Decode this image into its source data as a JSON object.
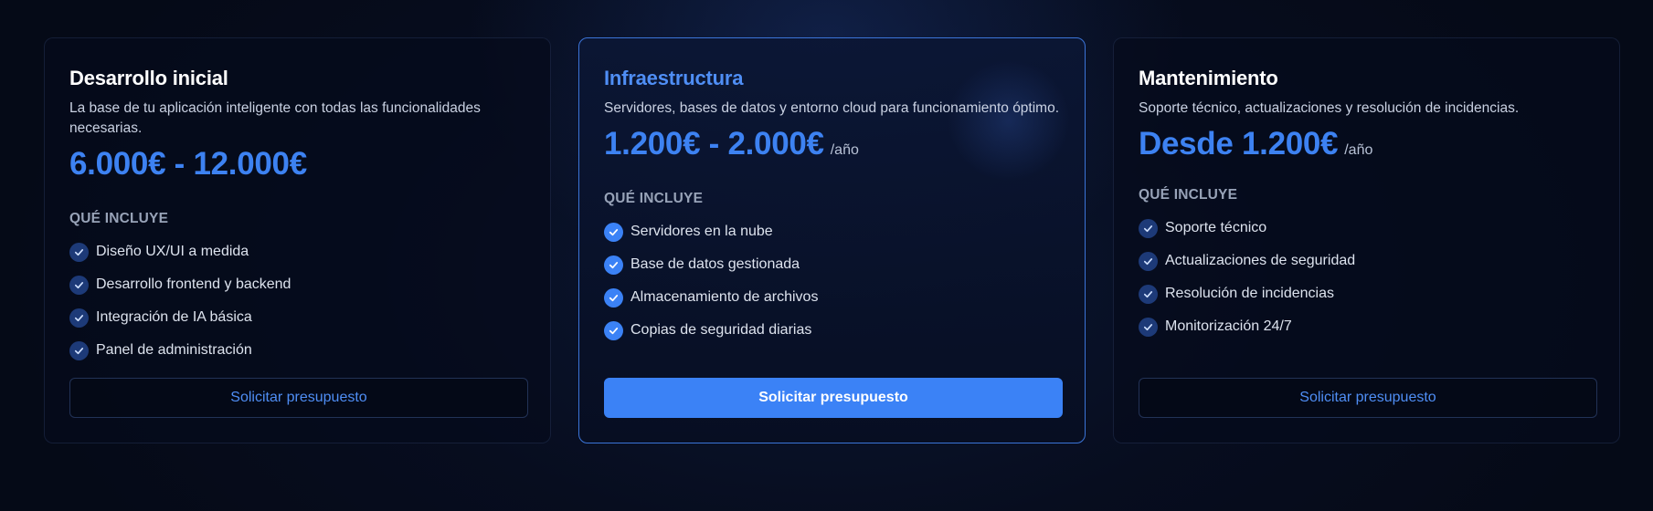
{
  "plans": [
    {
      "title": "Desarrollo inicial",
      "description": "La base de tu aplicación inteligente con todas las funcionalidades necesarias.",
      "price": "6.000€ - 12.000€",
      "period": "",
      "includes_label": "QUÉ INCLUYE",
      "features": [
        "Diseño UX/UI a medida",
        "Desarrollo frontend y backend",
        "Integración de IA básica",
        "Panel de administración"
      ],
      "button_label": "Solicitar presupuesto",
      "highlighted": false
    },
    {
      "title": "Infraestructura",
      "description": "Servidores, bases de datos y entorno cloud para funcionamiento óptimo.",
      "price": "1.200€ - 2.000€",
      "period": "/año",
      "includes_label": "QUÉ INCLUYE",
      "features": [
        "Servidores en la nube",
        "Base de datos gestionada",
        "Almacenamiento de archivos",
        "Copias de seguridad diarias"
      ],
      "button_label": "Solicitar presupuesto",
      "highlighted": true
    },
    {
      "title": "Mantenimiento",
      "description": "Soporte técnico, actualizaciones y resolución de incidencias.",
      "price": "Desde 1.200€",
      "period": "/año",
      "includes_label": "QUÉ INCLUYE",
      "features": [
        "Soporte técnico",
        "Actualizaciones de seguridad",
        "Resolución de incidencias",
        "Monitorización 24/7"
      ],
      "button_label": "Solicitar presupuesto",
      "highlighted": false
    }
  ],
  "icons": {
    "feature": "check-circle-icon"
  },
  "colors": {
    "accent": "#3b82f6",
    "price": "#3d82f2",
    "highlight_border": "#3b74d8",
    "background": "#070d1f"
  }
}
